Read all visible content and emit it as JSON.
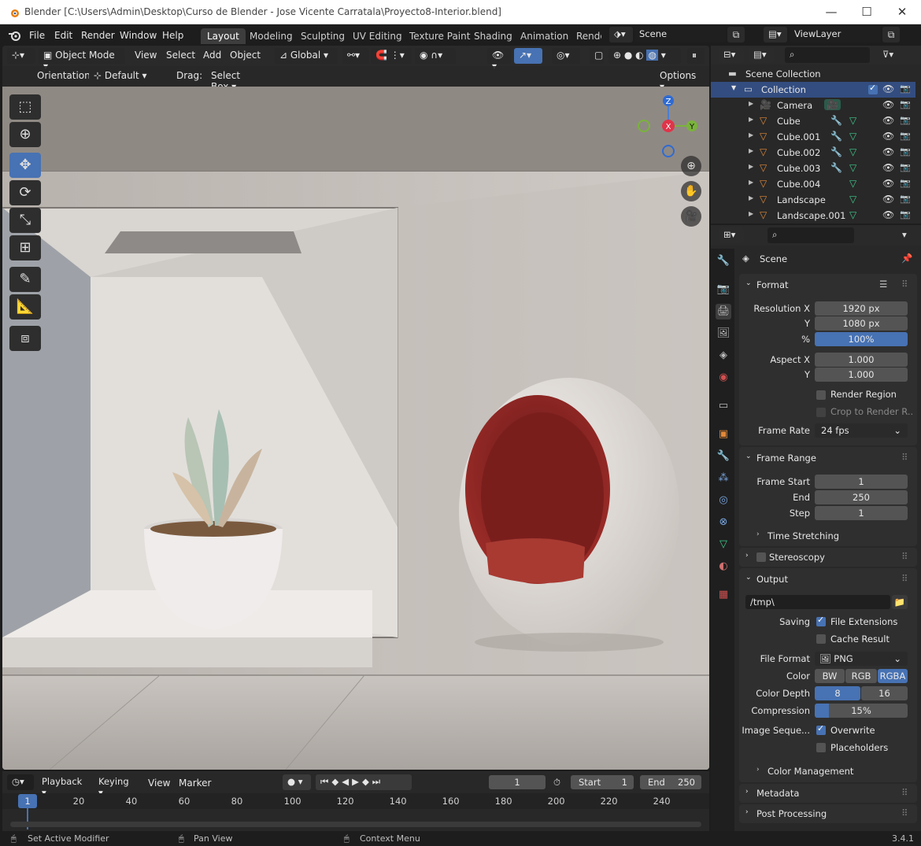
{
  "window": {
    "title": "Blender [C:\\Users\\Admin\\Desktop\\Curso de Blender - Jose Vicente Carratala\\Proyecto8-Interior.blend]",
    "minimize": "—",
    "maximize": "☐",
    "close": "✕"
  },
  "menubar": {
    "items": [
      "File",
      "Edit",
      "Render",
      "Window",
      "Help"
    ],
    "workspaces": [
      "Layout",
      "Modeling",
      "Sculpting",
      "UV Editing",
      "Texture Paint",
      "Shading",
      "Animation",
      "Rende"
    ],
    "active_workspace": "Layout",
    "scene": "Scene",
    "view_layer": "ViewLayer"
  },
  "viewport": {
    "mode": "Object Mode",
    "menus": [
      "View",
      "Select",
      "Add",
      "Object"
    ],
    "transform_orientation": "Global",
    "orientation_label": "Orientation:",
    "orientation_value": "Default",
    "drag_label": "Drag:",
    "drag_value": "Select Box",
    "options": "Options",
    "gizmo": {
      "z": "Z",
      "x": "X",
      "y": "Y"
    }
  },
  "outliner": {
    "root": "Scene Collection",
    "collection": "Collection",
    "items": [
      {
        "name": "Camera",
        "icon": "camera-icon"
      },
      {
        "name": "Cube",
        "icon": "mesh-icon"
      },
      {
        "name": "Cube.001",
        "icon": "mesh-icon"
      },
      {
        "name": "Cube.002",
        "icon": "mesh-icon"
      },
      {
        "name": "Cube.003",
        "icon": "mesh-icon"
      },
      {
        "name": "Cube.004",
        "icon": "mesh-icon"
      },
      {
        "name": "Landscape",
        "icon": "mesh-icon"
      },
      {
        "name": "Landscape.001",
        "icon": "mesh-icon"
      }
    ]
  },
  "properties": {
    "context": "Scene",
    "format": {
      "header": "Format",
      "resolution_x_label": "Resolution X",
      "resolution_x": "1920 px",
      "y_label": "Y",
      "resolution_y": "1080 px",
      "pct_label": "%",
      "resolution_pct": "100%",
      "aspect_x_label": "Aspect X",
      "aspect_x": "1.000",
      "aspect_y_label": "Y",
      "aspect_y": "1.000",
      "render_region": "Render Region",
      "crop": "Crop to Render R...",
      "frame_rate_label": "Frame Rate",
      "frame_rate": "24 fps"
    },
    "frame_range": {
      "header": "Frame Range",
      "start_label": "Frame Start",
      "start": "1",
      "end_label": "End",
      "end": "250",
      "step_label": "Step",
      "step": "1",
      "time_stretching": "Time Stretching"
    },
    "stereoscopy": "Stereoscopy",
    "output": {
      "header": "Output",
      "path": "/tmp\\",
      "saving_label": "Saving",
      "file_extensions": "File Extensions",
      "cache_result": "Cache Result",
      "file_format_label": "File Format",
      "file_format": "PNG",
      "color_label": "Color",
      "color_options": [
        "BW",
        "RGB",
        "RGBA"
      ],
      "color_selected": "RGBA",
      "depth_label": "Color Depth",
      "depth_options": [
        "8",
        "16"
      ],
      "depth_selected": "8",
      "compression_label": "Compression",
      "compression": "15%",
      "compression_fraction": 0.15,
      "image_seq_label": "Image Seque...",
      "overwrite": "Overwrite",
      "placeholders": "Placeholders",
      "color_management": "Color Management"
    },
    "metadata": "Metadata",
    "post_processing": "Post Processing"
  },
  "timeline": {
    "menus": [
      "Playback",
      "Keying",
      "View",
      "Marker"
    ],
    "current_frame": "1",
    "start_label": "Start",
    "start": "1",
    "end_label": "End",
    "end": "250",
    "ticks": [
      "1",
      "20",
      "40",
      "60",
      "80",
      "100",
      "120",
      "140",
      "160",
      "180",
      "200",
      "220",
      "240"
    ]
  },
  "statusbar": {
    "left": "Set Active Modifier",
    "middle": "Pan View",
    "right": "Context Menu",
    "version": "3.4.1"
  },
  "colors": {
    "accent": "#4772b3",
    "background": "#1d1d1d",
    "panel": "#282828",
    "chair_red": "#8c2020"
  }
}
